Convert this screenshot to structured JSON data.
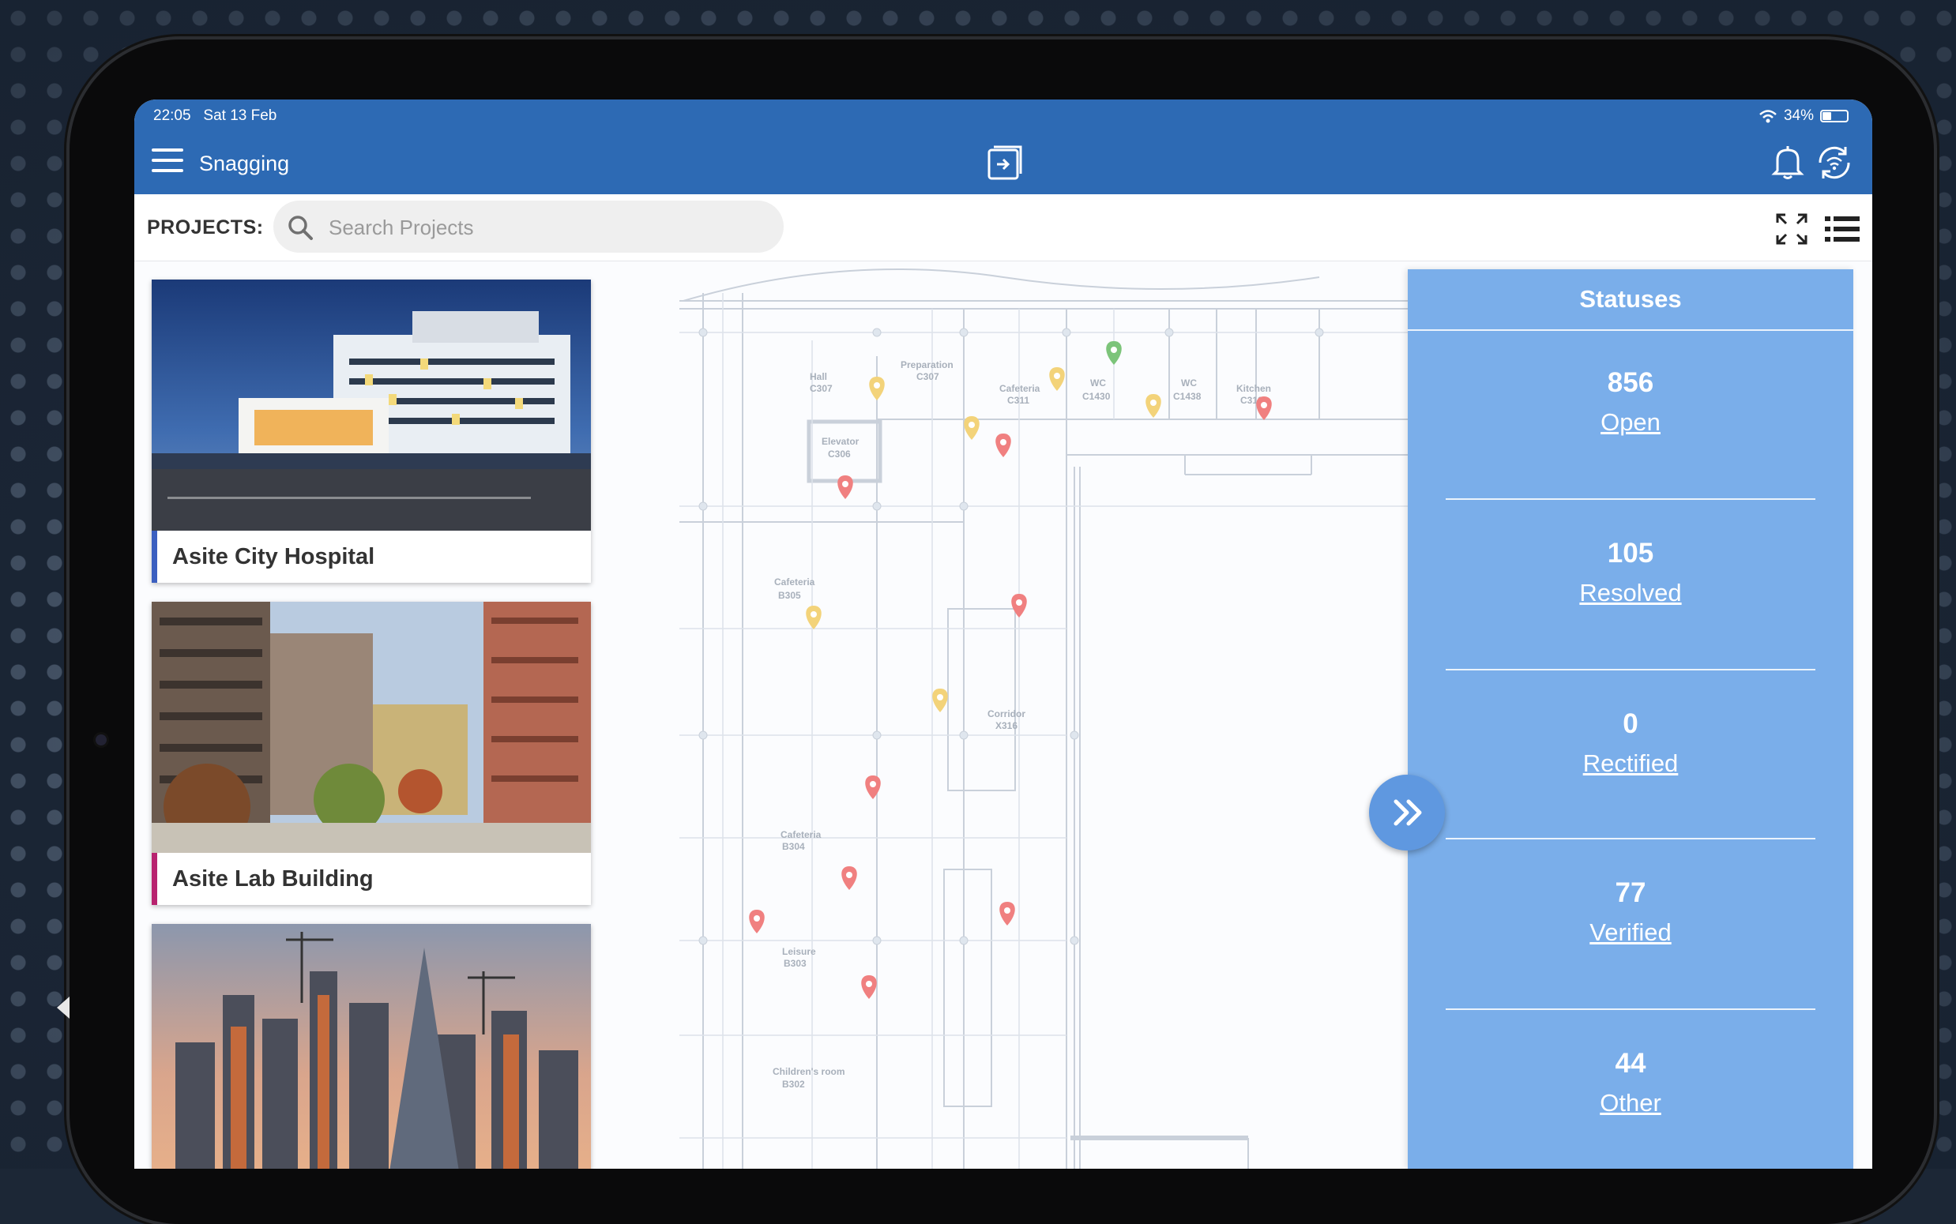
{
  "status_bar": {
    "time": "22:05",
    "date": "Sat 13 Feb",
    "battery": "34%"
  },
  "header": {
    "title": "Snagging"
  },
  "toolbar": {
    "projects_label": "PROJECTS:",
    "search_placeholder": "Search Projects"
  },
  "projects": [
    {
      "name": "Asite City Hospital",
      "accent": "#3b5fc0"
    },
    {
      "name": "Asite Lab Building",
      "accent": "#b8236f"
    },
    {
      "name": "",
      "accent": "#e8c81e"
    }
  ],
  "statuses": {
    "title": "Statuses",
    "items": [
      {
        "count": "856",
        "label": "Open"
      },
      {
        "count": "105",
        "label": "Resolved"
      },
      {
        "count": "0",
        "label": "Rectified"
      },
      {
        "count": "77",
        "label": "Verified"
      },
      {
        "count": "44",
        "label": "Other"
      }
    ]
  },
  "drawing_labels": {
    "hall": "Hall",
    "preparation": "Preparation",
    "cafeteria": "Cafeteria",
    "wc": "WC",
    "kitchen": "Kitchen",
    "elevator": "Elevator",
    "corridor": "Corridor",
    "leisure": "Leisure",
    "childrens_room": "Children's room",
    "c307a": "C307",
    "c307b": "C307",
    "c311": "C311",
    "c1430": "C1430",
    "c1438": "C1438",
    "c312": "C312",
    "c306": "C306",
    "b305": "B305",
    "x316": "X316",
    "b304": "B304",
    "b303": "B303",
    "b302": "B302"
  },
  "colors": {
    "header": "#2d6ab4",
    "panel": "#7aaeea",
    "pin_red": "#f08080",
    "pin_yellow": "#f3d37a",
    "pin_green": "#7cc47a"
  },
  "icons": [
    "menu-icon",
    "app-logo-icon",
    "bell-icon",
    "sync-icon",
    "wifi-icon",
    "battery-icon",
    "search-icon",
    "expand-icon",
    "list-view-icon",
    "chevron-double-right-icon"
  ]
}
